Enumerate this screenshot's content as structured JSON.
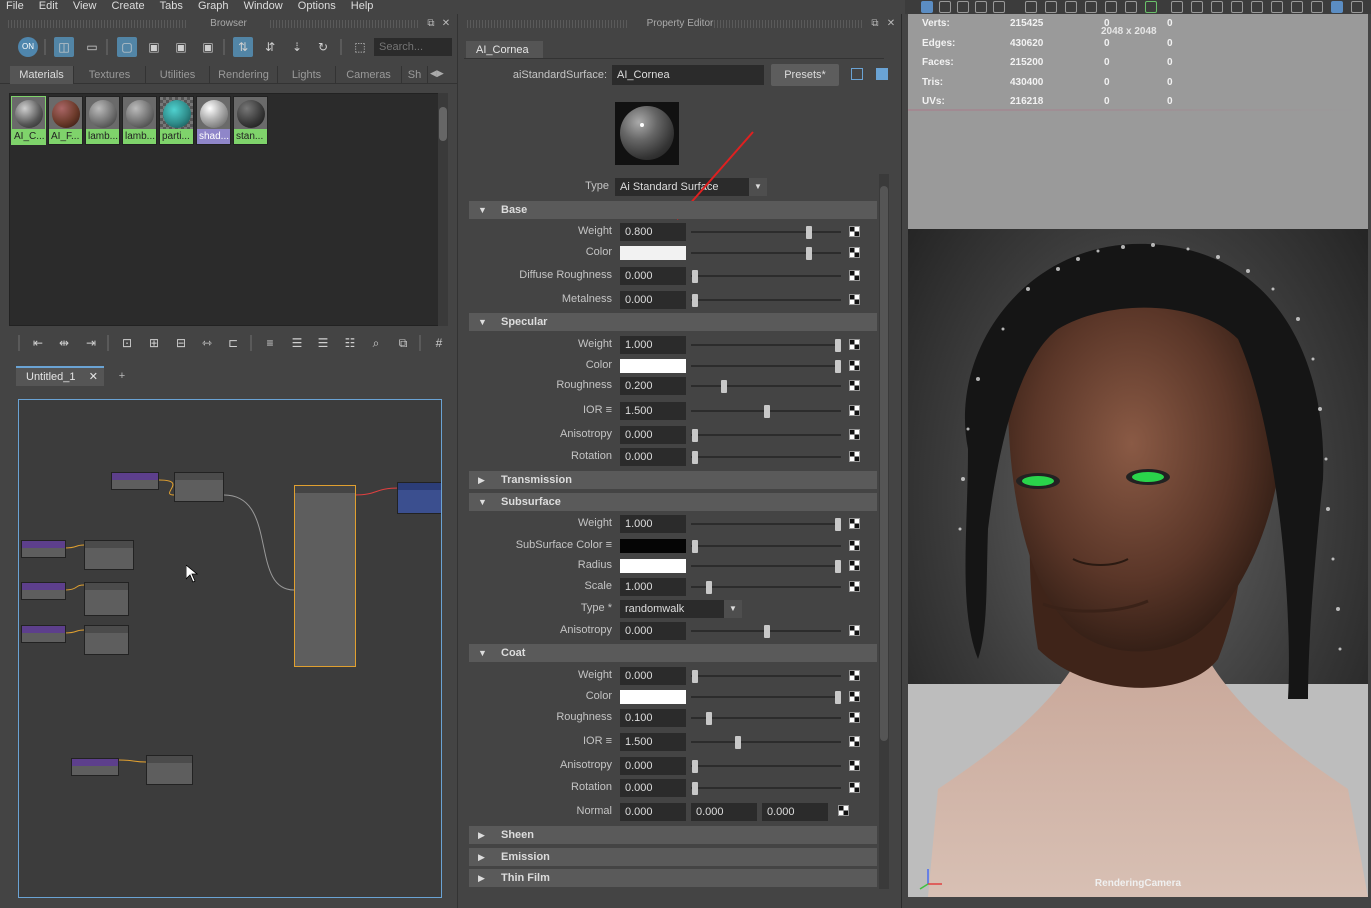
{
  "menu": [
    "File",
    "Edit",
    "View",
    "Create",
    "Tabs",
    "Graph",
    "Window",
    "Options",
    "Help"
  ],
  "browser": {
    "title": "Browser",
    "search_placeholder": "Search...",
    "tabs": [
      "Materials",
      "Textures",
      "Utilities",
      "Rendering",
      "Lights",
      "Cameras",
      "Sh"
    ],
    "swatches": [
      {
        "label": "AI_C...",
        "color": "#6e6e6e"
      },
      {
        "label": "AI_F...",
        "color": "#6b3a2a"
      },
      {
        "label": "lamb...",
        "color": "#707070"
      },
      {
        "label": "lamb...",
        "color": "#707070"
      },
      {
        "label": "parti...",
        "color": "#2f8c8a"
      },
      {
        "label": "shad...",
        "color": "#b5b5b5"
      },
      {
        "label": "stan...",
        "color": "#3a3a3a"
      }
    ]
  },
  "graph": {
    "tab": "Untitled_1",
    "add_tab": "+"
  },
  "property_editor": {
    "title": "Property Editor",
    "tab": "AI_Cornea",
    "surface_label": "aiStandardSurface:",
    "surface_value": "AI_Cornea",
    "presets": "Presets*",
    "type_label": "Type",
    "type_value": "Ai Standard Surface",
    "base": {
      "title": "Base",
      "weight_label": "Weight",
      "weight": "0.800",
      "color_label": "Color",
      "diffuse_roughness_label": "Diffuse Roughness",
      "diffuse_roughness": "0.000",
      "metalness_label": "Metalness",
      "metalness": "0.000"
    },
    "specular": {
      "title": "Specular",
      "weight_label": "Weight",
      "weight": "1.000",
      "color_label": "Color",
      "roughness_label": "Roughness",
      "roughness": "0.200",
      "ior_label": "IOR ≡",
      "ior": "1.500",
      "anisotropy_label": "Anisotropy",
      "anisotropy": "0.000",
      "rotation_label": "Rotation",
      "rotation": "0.000"
    },
    "transmission": {
      "title": "Transmission"
    },
    "subsurface": {
      "title": "Subsurface",
      "weight_label": "Weight",
      "weight": "1.000",
      "color_label": "SubSurface Color ≡",
      "radius_label": "Radius",
      "scale_label": "Scale",
      "scale": "1.000",
      "type_label": "Type *",
      "type": "randomwalk",
      "anisotropy_label": "Anisotropy",
      "anisotropy": "0.000"
    },
    "coat": {
      "title": "Coat",
      "weight_label": "Weight",
      "weight": "0.000",
      "color_label": "Color",
      "roughness_label": "Roughness",
      "roughness": "0.100",
      "ior_label": "IOR ≡",
      "ior": "1.500",
      "anisotropy_label": "Anisotropy",
      "anisotropy": "0.000",
      "rotation_label": "Rotation",
      "rotation": "0.000",
      "normal_label": "Normal",
      "normal": [
        "0.000",
        "0.000",
        "0.000"
      ]
    },
    "sheen": {
      "title": "Sheen"
    },
    "emission": {
      "title": "Emission"
    },
    "thin_film": {
      "title": "Thin Film"
    }
  },
  "viewport": {
    "hud": [
      {
        "label": "Verts:",
        "v1": "215425",
        "v2": "0",
        "v3": "0"
      },
      {
        "label": "Edges:",
        "v1": "430620",
        "v2": "0",
        "v3": "0"
      },
      {
        "label": "Faces:",
        "v1": "215200",
        "v2": "0",
        "v3": "0"
      },
      {
        "label": "Tris:",
        "v1": "430400",
        "v2": "0",
        "v3": "0"
      },
      {
        "label": "UVs:",
        "v1": "216218",
        "v2": "0",
        "v3": "0"
      }
    ],
    "resolution": "2048 x 2048",
    "camera": "RenderingCamera"
  },
  "colors": {
    "accent": "#5285a6",
    "swatch_selected": "#7fd36b",
    "arrow": "#e02020"
  }
}
